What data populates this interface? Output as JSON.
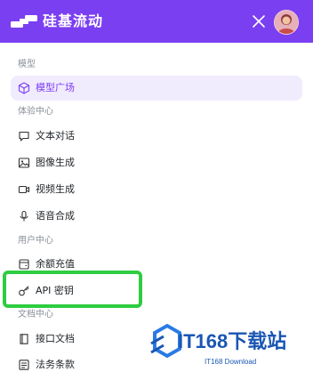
{
  "header": {
    "app_name": "硅基流动",
    "logo_icon": "siliconflow-logo-icon",
    "close_icon": "close-icon",
    "avatar_icon": "user-avatar",
    "bg_color": "#7b3ff2"
  },
  "nav": {
    "sections": [
      {
        "label": "模型",
        "items": [
          {
            "label": "模型广场",
            "icon": "cube-icon",
            "active": true
          }
        ]
      },
      {
        "label": "体验中心",
        "items": [
          {
            "label": "文本对话",
            "icon": "chat-icon"
          },
          {
            "label": "图像生成",
            "icon": "image-icon"
          },
          {
            "label": "视频生成",
            "icon": "video-icon"
          },
          {
            "label": "语音合成",
            "icon": "microphone-icon"
          }
        ]
      },
      {
        "label": "用户中心",
        "items": [
          {
            "label": "余额充值",
            "icon": "wallet-icon"
          },
          {
            "label": "API 密钥",
            "icon": "key-icon"
          }
        ]
      },
      {
        "label": "文档中心",
        "items": [
          {
            "label": "接口文档",
            "icon": "book-icon"
          },
          {
            "label": "法务条款",
            "icon": "document-icon"
          }
        ]
      }
    ]
  },
  "highlight_color": "#2ecc40",
  "watermark": {
    "brand": "IT168下载站",
    "sub": "IT168 Download"
  }
}
